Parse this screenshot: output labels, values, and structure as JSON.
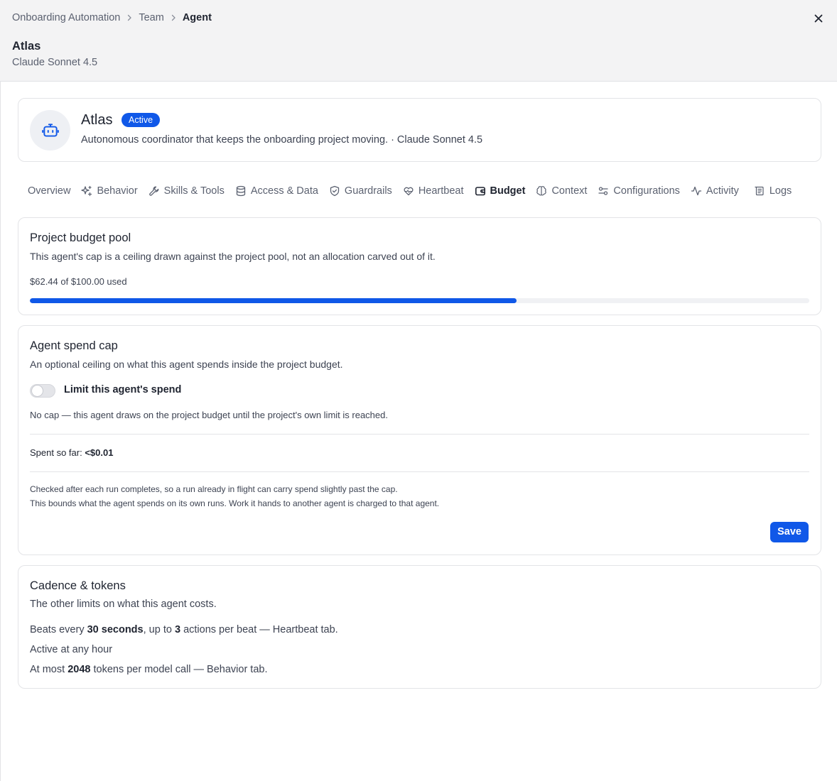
{
  "breadcrumb": {
    "items": [
      "Onboarding Automation",
      "Team",
      "Agent"
    ]
  },
  "header": {
    "title": "Atlas",
    "subtitle": "Claude Sonnet 4.5"
  },
  "agent": {
    "name": "Atlas",
    "status": "Active",
    "description": "Autonomous coordinator that keeps the onboarding project moving. · Claude Sonnet 4.5",
    "icon": "robot-icon"
  },
  "tabs": [
    {
      "label": "Overview",
      "icon": ""
    },
    {
      "label": "Behavior",
      "icon": "sparkles-icon"
    },
    {
      "label": "Skills & Tools",
      "icon": "wrench-icon"
    },
    {
      "label": "Access & Data",
      "icon": "database-icon"
    },
    {
      "label": "Guardrails",
      "icon": "shield-icon"
    },
    {
      "label": "Heartbeat",
      "icon": "heart-pulse-icon"
    },
    {
      "label": "Budget",
      "icon": "wallet-icon",
      "active": true
    },
    {
      "label": "Context",
      "icon": "brain-icon"
    },
    {
      "label": "Configurations",
      "icon": "sliders-icon"
    },
    {
      "label": "Activity",
      "icon": "activity-icon"
    },
    {
      "label": "Logs",
      "icon": "logs-icon"
    }
  ],
  "budget_pool": {
    "title": "Project budget pool",
    "subtitle": "This agent's cap is a ceiling drawn against the project pool, not an allocation carved out of it.",
    "usage_text": "$62.44 of $100.00 used",
    "used_fraction": 0.6244
  },
  "spend_cap": {
    "title": "Agent spend cap",
    "subtitle": "An optional ceiling on what this agent spends inside the project budget.",
    "toggle_label": "Limit this agent's spend",
    "toggle_on": false,
    "no_cap_text": "No cap — this agent draws on the project budget until the project's own limit is reached.",
    "spent_label": "Spent so far:",
    "spent_value": "<$0.01",
    "note_1": "Checked after each run completes, so a run already in flight can carry spend slightly past the cap.",
    "note_2": "This bounds what the agent spends on its own runs. Work it hands to another agent is charged to that agent.",
    "save_label": "Save"
  },
  "cadence": {
    "title": "Cadence & tokens",
    "subtitle": "The other limits on what this agent costs.",
    "beats_prefix": "Beats every",
    "beats_interval": "30 seconds",
    "beats_mid": ", up to",
    "beats_actions": "3",
    "beats_suffix": "actions per beat — Heartbeat tab.",
    "active_hours": "Active at any hour",
    "tokens_prefix": "At most",
    "tokens_value": "2048",
    "tokens_suffix": "tokens per model call — Behavior tab."
  },
  "colors": {
    "accent": "#1058e8",
    "header_bg": "#f3f3f4",
    "border": "#e3e4e7"
  }
}
